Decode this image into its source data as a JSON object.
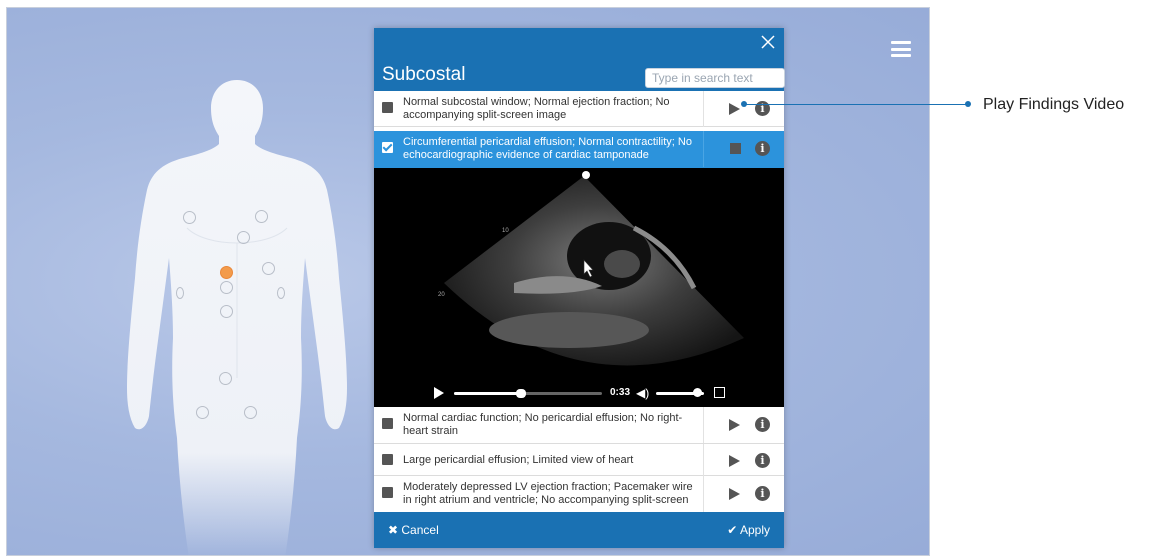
{
  "panel": {
    "title": "Subcostal",
    "search_placeholder": "Type in search text",
    "close_icon": "close-icon"
  },
  "findings": [
    {
      "text": "Normal subcostal window; Normal ejection fraction; No accompanying split-screen image",
      "selected": false
    },
    {
      "text": "Circumferential pericardial effusion; Normal contractility; No echocardiographic evidence of cardiac tamponade",
      "selected": true
    },
    {
      "text": "Normal cardiac function; No pericardial effusion; No right-heart strain",
      "selected": false
    },
    {
      "text": "Large pericardial effusion; Limited view of heart",
      "selected": false
    },
    {
      "text": "Moderately depressed LV ejection fraction; Pacemaker wire in right atrium and ventricle; No accompanying split-screen",
      "selected": false
    }
  ],
  "video": {
    "time": "0:33",
    "progress": 0.45,
    "volume": 0.85,
    "depth_labels": [
      "10",
      "20"
    ]
  },
  "footer": {
    "cancel": "✖ Cancel",
    "apply": "✔ Apply"
  },
  "callout": {
    "label": "Play Findings Video"
  },
  "colors": {
    "accent": "#1a71b3",
    "selected_row": "#2c93dc",
    "active_point": "#f39b4b"
  }
}
